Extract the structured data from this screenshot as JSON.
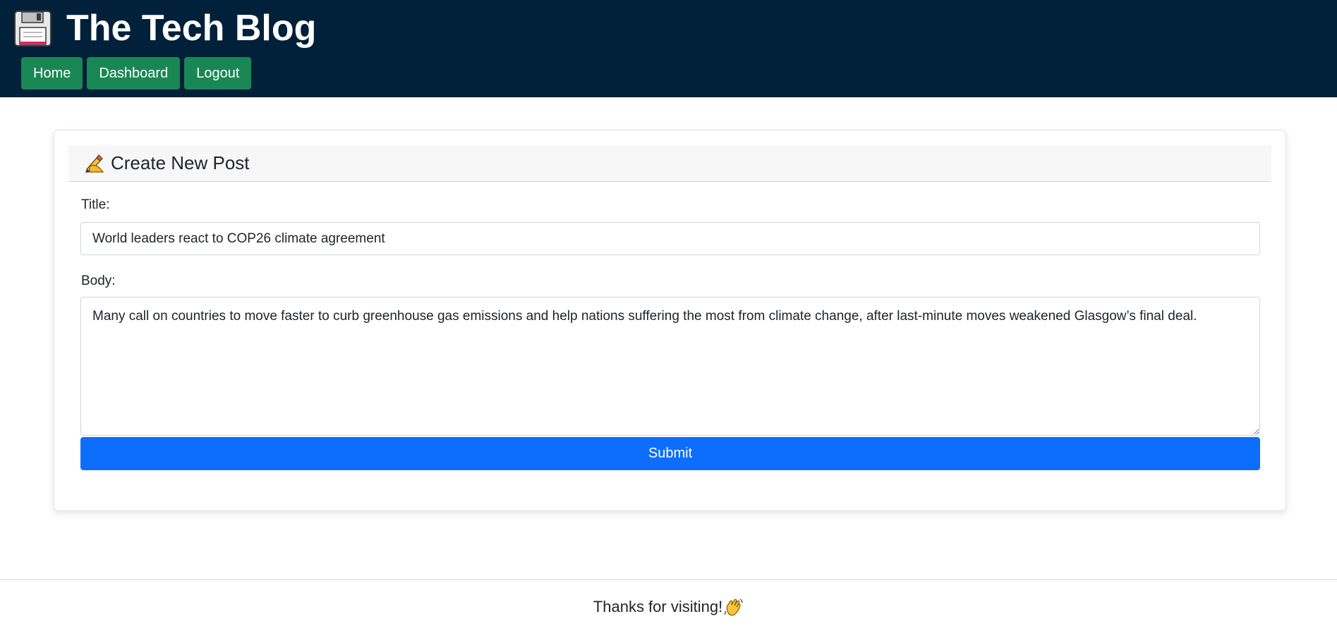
{
  "header": {
    "brand_icon": "floppy-disk-icon",
    "title": "The Tech Blog",
    "nav": {
      "home_label": "Home",
      "dashboard_label": "Dashboard",
      "logout_label": "Logout"
    }
  },
  "form": {
    "header_icon": "writing-hand-icon",
    "heading": "Create New Post",
    "title_label": "Title:",
    "title_value": "World leaders react to COP26 climate agreement",
    "body_label": "Body:",
    "body_value": "Many call on countries to move faster to curb greenhouse gas emissions and help nations suffering the most from climate change, after last-minute moves weakened Glasgow’s final deal.",
    "submit_label": "Submit"
  },
  "footer": {
    "text": "Thanks for visiting!",
    "icon": "waving-hand-icon"
  },
  "colors": {
    "header_bg": "#012039",
    "nav_button": "#198754",
    "submit_button": "#0d6efd"
  }
}
